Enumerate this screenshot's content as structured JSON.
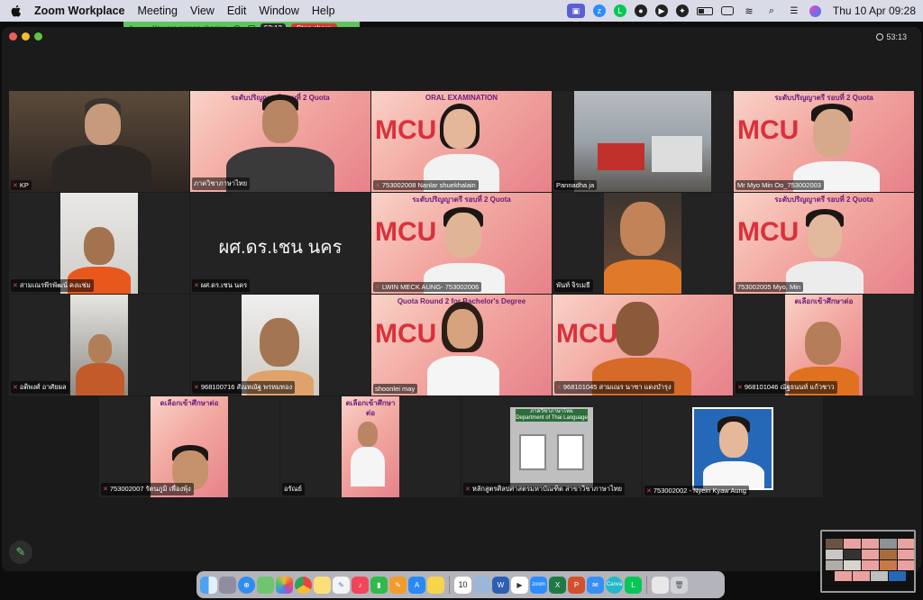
{
  "menubar": {
    "app_name": "Zoom Workplace",
    "menus": [
      "Meeting",
      "View",
      "Edit",
      "Window",
      "Help"
    ],
    "clock": "Thu 10 Apr  09:28"
  },
  "sharebar": {
    "status": "You are screen sharing",
    "timer": "53:13",
    "stop_label": "Stop share"
  },
  "window": {
    "timer": "53:13"
  },
  "participants": [
    {
      "name": "KP",
      "muted": true
    },
    {
      "name": "ภาควิชาภาษาไทย",
      "muted": false
    },
    {
      "name": "753002008 Nanlar shuekhalain",
      "muted": true
    },
    {
      "name": "Pannadha ja",
      "muted": false
    },
    {
      "name": "Mr Myo Min Oo_753002003",
      "muted": false
    },
    {
      "name": "สามเณรพีรพัฒน์ คงแช่ม",
      "muted": true
    },
    {
      "name": "ผศ.ดร.เชน นคร",
      "muted": true,
      "display_name": "ผศ.ดร.เชน นคร"
    },
    {
      "name": "LWIN MECK AUNG- 753002006",
      "muted": true
    },
    {
      "name": "พันท์ จิรเมธี",
      "muted": false
    },
    {
      "name": "753002005 Myo, Min",
      "muted": false
    },
    {
      "name": "อติพงศ์ อาศัยผล",
      "muted": true
    },
    {
      "name": "968100716 สัณหณัฐ พรหมทอง",
      "muted": true
    },
    {
      "name": "shoonlei may",
      "muted": false
    },
    {
      "name": "968101045 สามเณร นาซา แดงบำรุง",
      "muted": true
    },
    {
      "name": "968101046 ณัฐธนนท์ แก้วชาว",
      "muted": true
    },
    {
      "name": "753002007 รัตนภูมิ เพื่องพุ้ง",
      "muted": true
    },
    {
      "name": "อรัณย์",
      "muted": false
    },
    {
      "name": "หลักสูตรศิลปศาสตรมหาบัณฑิต สาขาวิชาภาษาไทย",
      "muted": true
    },
    {
      "name": "753002002 - Nyein Kyaw Aung",
      "muted": true
    }
  ],
  "banner_texts": {
    "oral": "ORAL EXAMINATION",
    "quota_en": "Quota Round 2 for Bachelor's Degree",
    "quota_th": "ระดับปริญญาตรี รอบที่ 2 Quota",
    "select_th": "ดเลือกเข้าศึกษาต่อ",
    "mcu": "MCU",
    "dept_sign": "ภาควิชาภาษาไทย",
    "dept_sign_en": "Department of Thai Language"
  },
  "dock": {
    "date_icon": "10",
    "apps": [
      "finder-icon",
      "launchpad-icon",
      "safari-icon",
      "maps-icon",
      "photos-icon",
      "chrome-icon",
      "notes-icon",
      "freeform-icon",
      "music-icon",
      "numbers-icon",
      "pages-icon",
      "appstore-icon",
      "stickies-icon",
      "calendar-icon",
      "preview-icon",
      "word-icon",
      "facetime-icon",
      "zoom-icon",
      "line-icon",
      "excel-icon",
      "powerpoint-icon",
      "mail-icon",
      "canva-icon",
      "messages-icon",
      "downloads-icon",
      "trash-icon"
    ]
  }
}
